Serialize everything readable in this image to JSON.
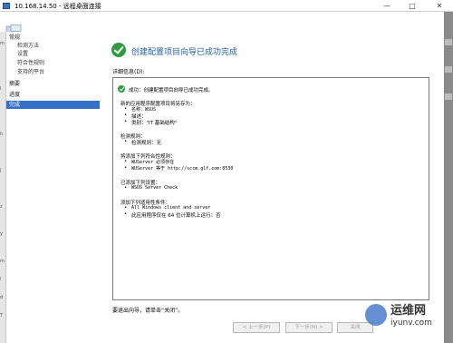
{
  "window": {
    "title": "10.168.14.50 - 远程桌面连接",
    "min_glyph": "—",
    "max_glyph": "□",
    "close_glyph": "✕"
  },
  "nav": {
    "items": [
      {
        "label": "常规",
        "level": 0
      },
      {
        "label": "检测方法",
        "level": 1
      },
      {
        "label": "设置",
        "level": 1
      },
      {
        "label": "符合性规则",
        "level": 1
      },
      {
        "label": "支持的平台",
        "level": 1
      },
      {
        "label": "摘要",
        "level": 0
      },
      {
        "label": "进度",
        "level": 0
      },
      {
        "label": "完成",
        "level": 0,
        "active": true
      }
    ]
  },
  "left_strip": [
    "m",
    "l",
    "h",
    "j",
    "z",
    "y",
    "m",
    "l",
    "d",
    "T"
  ],
  "header": {
    "title": "创建配置项目向导已成功完成"
  },
  "details": {
    "label": "详细信息(D):",
    "success": "成功：创建配置项目向导已成功完成。",
    "props_heading": "新的应用程序配置项目将另存为：",
    "props": [
      "名称：WSUS",
      "描述：",
      "类别：\"IT 基础结构\""
    ],
    "detect_heading": "检测规则：",
    "detect": [
      "检测规则：无"
    ],
    "compliance_heading": "将添加下列符合性规则：",
    "compliance": [
      "WUServer 必须存在",
      "WUServer 等于 http://sccm.glf.com:8530"
    ],
    "settings_heading": "已添加下列设置：",
    "settings": [
      "WSUS Server Check"
    ],
    "platform_heading": "添加下列适用性条件：",
    "platform": [
      "All Windows client and server",
      "此应用程序仅在 64 位计算机上运行：否"
    ]
  },
  "hint": "要退出向导，请单击“关闭”。",
  "buttons": {
    "prev": "< 上一步(P)",
    "next": "下一步(N) >",
    "close": "关闭"
  },
  "watermark": {
    "cn": "运维网",
    "en": "iyunv.com"
  },
  "colors": {
    "accent": "#3370c8",
    "title_blue": "#1f5da8",
    "success_green": "#2f9a3e"
  }
}
